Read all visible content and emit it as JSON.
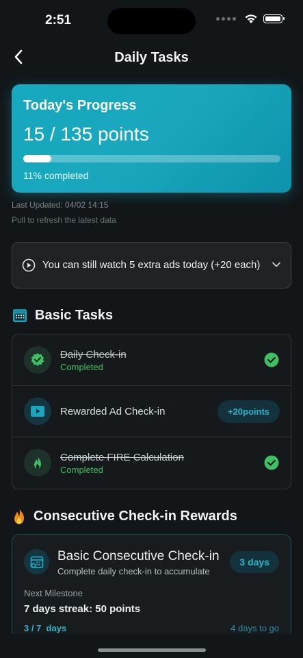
{
  "status_bar": {
    "time": "2:51"
  },
  "nav": {
    "title": "Daily Tasks"
  },
  "progress": {
    "title": "Today's Progress",
    "points_text": "15 / 135 points",
    "fraction": 0.11,
    "percent_text": "11% completed"
  },
  "updates": {
    "last_updated": "Last Updated: 04/02 14:15",
    "pull_hint": "Pull to refresh the latest data"
  },
  "ads_banner": {
    "text": "You can still watch 5 extra ads today (+20 each)"
  },
  "basic_tasks": {
    "title": "Basic Tasks",
    "items": [
      {
        "name": "Daily Check-in",
        "status": "Completed",
        "done": true,
        "icon": "verified-badge-icon"
      },
      {
        "name": "Rewarded Ad Check-in",
        "reward": "+20points",
        "done": false,
        "icon": "play-video-icon"
      },
      {
        "name": "Complete FIRE Calculation",
        "status": "Completed",
        "done": true,
        "icon": "flame-icon"
      }
    ]
  },
  "streak": {
    "section_title": "Consecutive Check-in Rewards",
    "card_title": "Basic Consecutive Check-in",
    "card_subtitle": "Complete daily check-in to accumulate",
    "days_badge": "3 days",
    "next_label": "Next Milestone",
    "milestone": "7 days streak: 50 points",
    "count": "3 / 7  days",
    "remaining": "4 days to go"
  },
  "colors": {
    "accent": "#1aa7bd",
    "success": "#3fbf63",
    "background": "#121619"
  }
}
